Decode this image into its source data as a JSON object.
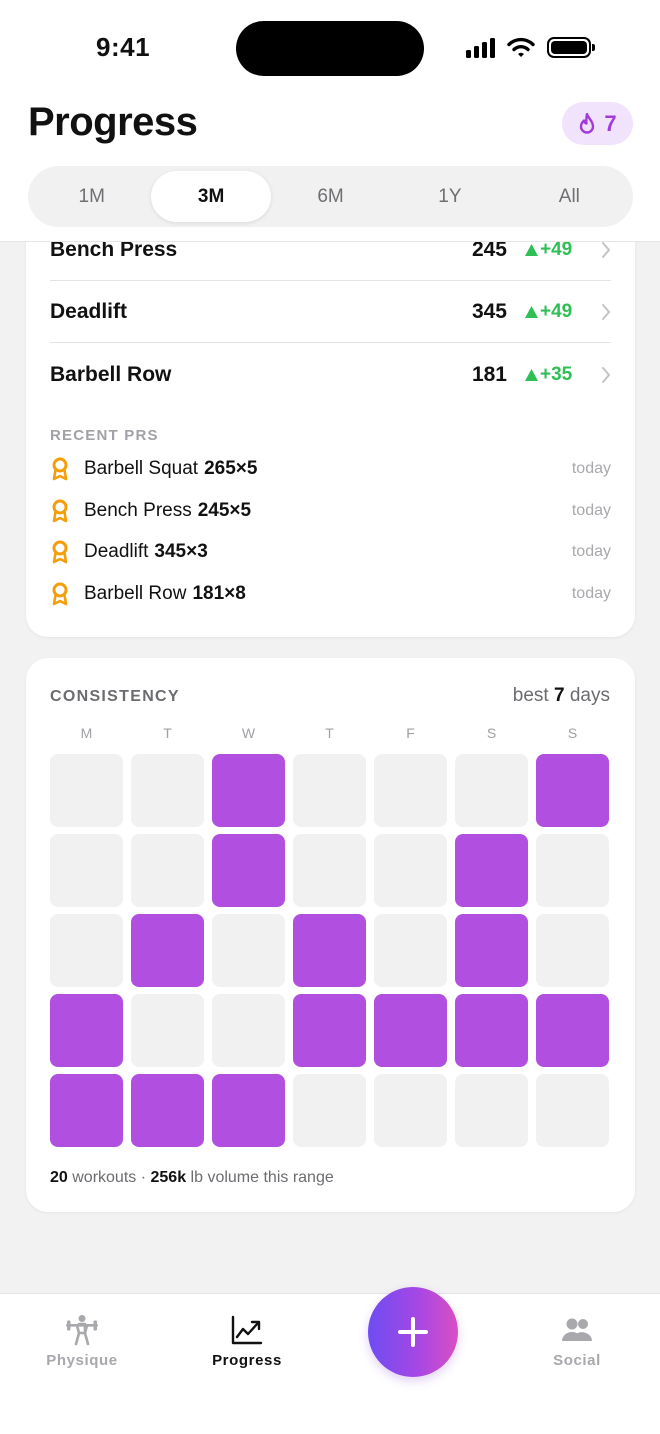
{
  "status_bar": {
    "time": "9:41"
  },
  "header": {
    "title": "Progress",
    "streak_count": "7",
    "streak_icon": "flame-icon"
  },
  "range_tabs": [
    {
      "label": "1M",
      "active": false
    },
    {
      "label": "3M",
      "active": true
    },
    {
      "label": "6M",
      "active": false
    },
    {
      "label": "1Y",
      "active": false
    },
    {
      "label": "All",
      "active": false
    }
  ],
  "lifts": [
    {
      "name": "Bench Press",
      "weight": "245",
      "delta": "+49"
    },
    {
      "name": "Deadlift",
      "weight": "345",
      "delta": "+49"
    },
    {
      "name": "Barbell Row",
      "weight": "181",
      "delta": "+35"
    }
  ],
  "recent_prs": {
    "label": "RECENT PRS",
    "items": [
      {
        "lift": "Barbell Squat",
        "sets": "265×5",
        "when": "today"
      },
      {
        "lift": "Bench Press",
        "sets": "245×5",
        "when": "today"
      },
      {
        "lift": "Deadlift",
        "sets": "345×3",
        "when": "today"
      },
      {
        "lift": "Barbell Row",
        "sets": "181×8",
        "when": "today"
      }
    ]
  },
  "consistency": {
    "title": "CONSISTENCY",
    "best_prefix": "best",
    "best_value": "7",
    "best_suffix": "days",
    "day_headers": [
      "M",
      "T",
      "W",
      "T",
      "F",
      "S",
      "S"
    ],
    "weeks": [
      [
        0,
        0,
        1,
        0,
        0,
        0,
        1
      ],
      [
        0,
        0,
        1,
        0,
        0,
        1,
        0
      ],
      [
        0,
        1,
        0,
        1,
        0,
        1,
        0
      ],
      [
        1,
        0,
        0,
        1,
        1,
        1,
        1
      ],
      [
        1,
        1,
        1,
        0,
        0,
        0,
        0
      ]
    ],
    "workouts_count": "20",
    "workouts_label": "workouts ·",
    "volume": "256k",
    "volume_label": "lb volume this range",
    "active_color": "#b150e0",
    "empty_color": "#f1f1f2"
  },
  "tab_bar": {
    "physique": "Physique",
    "progress": "Progress",
    "social": "Social",
    "add_icon": "plus-icon"
  },
  "colors": {
    "accent": "#b150e0",
    "positive": "#2fbf55",
    "pr_medal": "#f59e0b"
  }
}
